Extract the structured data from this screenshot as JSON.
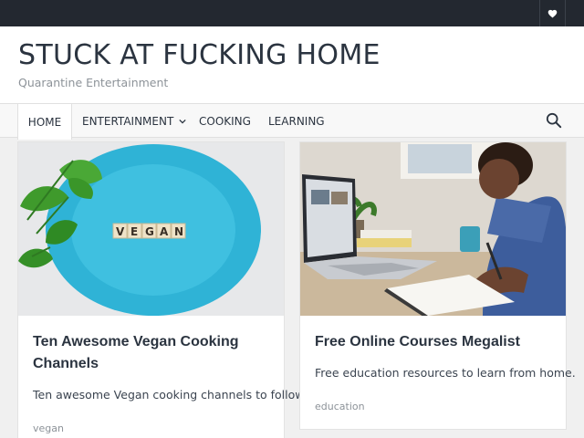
{
  "topbar": {
    "icon": "heart-icon"
  },
  "site": {
    "title": "STUCK AT FUCKING HOME",
    "tagline": "Quarantine Entertainment"
  },
  "nav": {
    "items": [
      {
        "label": "HOME",
        "active": true
      },
      {
        "label": "ENTERTAINMENT",
        "has_dropdown": true
      },
      {
        "label": "COOKING"
      },
      {
        "label": "LEARNING"
      }
    ],
    "search_icon": "search-icon"
  },
  "posts": [
    {
      "image_text": "VEGAN",
      "title_line1": "Ten Awesome Vegan Cooking",
      "title_line2": "Channels",
      "excerpt": "Ten awesome Vegan cooking channels to follow.",
      "tag": "vegan"
    },
    {
      "title": "Free Online Courses Megalist",
      "excerpt": "Free education resources to learn from home.",
      "tag": "education"
    }
  ],
  "colors": {
    "topbar": "#232830",
    "text": "#2b3440",
    "muted": "#8d9399",
    "plate": "#3bb8d8"
  }
}
